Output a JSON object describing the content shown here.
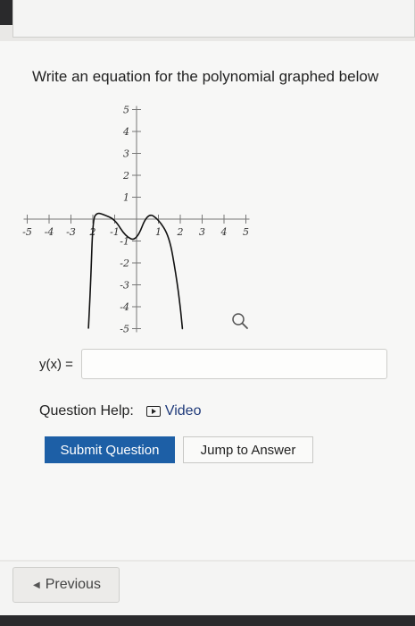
{
  "question": {
    "text": "Write an equation for the polynomial graphed below"
  },
  "answer": {
    "label": "y(x) =",
    "value": "",
    "placeholder": ""
  },
  "help": {
    "label": "Question Help:",
    "video_label": "Video"
  },
  "buttons": {
    "submit": "Submit Question",
    "jump": "Jump to Answer",
    "previous": "Previous"
  },
  "icons": {
    "zoom": "magnifier-icon",
    "video": "play-icon",
    "previous_arrow": "left-arrow-icon"
  },
  "chart_data": {
    "type": "line",
    "title": "",
    "xlabel": "",
    "ylabel": "",
    "xlim": [
      -5,
      5
    ],
    "ylim": [
      -5,
      5
    ],
    "x_ticks": [
      -5,
      -4,
      -3,
      -2,
      -1,
      1,
      2,
      3,
      4,
      5
    ],
    "x_tick_labels": [
      "-5",
      "-4",
      "-3",
      "2",
      "-1",
      "1",
      "2",
      "3",
      "4",
      "5"
    ],
    "y_ticks": [
      -5,
      -4,
      -3,
      -2,
      -1,
      1,
      2,
      3,
      4,
      5
    ],
    "y_tick_labels": [
      "-5",
      "-4",
      "-3",
      "-2",
      "-1",
      "1",
      "2",
      "3",
      "4",
      "5"
    ],
    "grid": false,
    "series": [
      {
        "x": [
          -2.2,
          -2.1,
          -2.0,
          -1.8,
          -1.5,
          -1.0,
          -0.5,
          0.0,
          0.5,
          1.0,
          1.5,
          1.8,
          2.0,
          2.1
        ],
        "y": [
          -5.0,
          -3.0,
          0.0,
          0.3,
          0.2,
          0.0,
          -0.8,
          -1.0,
          0.3,
          0.0,
          -0.8,
          -2.5,
          -4.0,
          -5.0
        ]
      }
    ],
    "color": "#111111"
  }
}
